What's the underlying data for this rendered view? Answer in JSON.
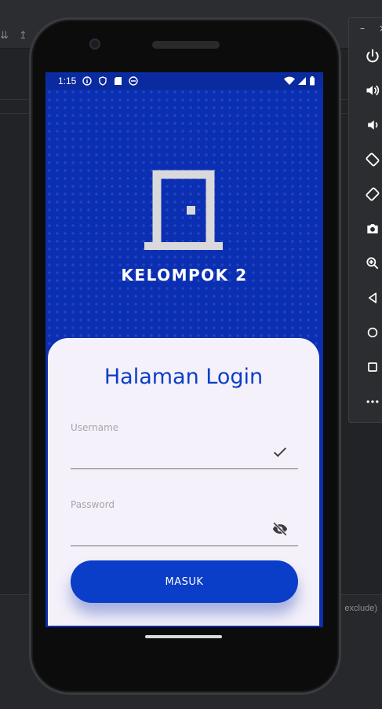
{
  "status_bar": {
    "time": "1:15"
  },
  "app": {
    "brand_name": "KELOMPOK 2",
    "login_title": "Halaman Login",
    "username": {
      "label": "Username",
      "value": ""
    },
    "password": {
      "label": "Password",
      "value": ""
    },
    "login_button_label": "MASUK"
  },
  "ide": {
    "exclude_text": "exclude)"
  },
  "colors": {
    "primary": "#0a3dc8",
    "header_bg": "#0b2fb2",
    "card_bg": "#f5f1fa",
    "label": "#a7a6ad"
  },
  "icons": {
    "hero": "door-icon",
    "username_status": "check-icon",
    "password_toggle": "eye-off-icon"
  }
}
